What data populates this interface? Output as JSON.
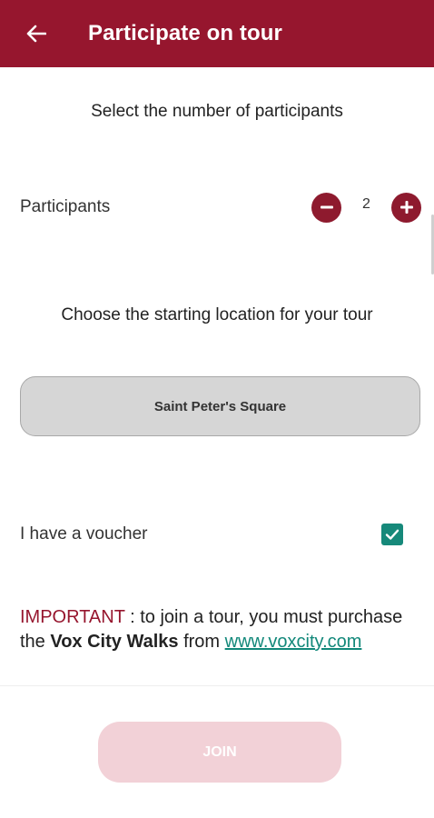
{
  "header": {
    "title": "Participate on tour",
    "back_icon": "arrow-left-icon",
    "background_color": "#96162e"
  },
  "participants_section": {
    "title": "Select the number of participants",
    "label": "Participants",
    "count": "2",
    "decrement_icon": "minus-circle-icon",
    "increment_icon": "plus-circle-icon"
  },
  "location_section": {
    "title": "Choose the starting location for your tour",
    "selected_location": "Saint Peter's Square"
  },
  "voucher": {
    "label": "I have a voucher",
    "checked": true,
    "checkbox_color": "#16897a"
  },
  "notice": {
    "important_label": "IMPORTANT",
    "text_before_brand": " : to join a tour, you must purchase the ",
    "brand": "Vox City Walks",
    "text_after_brand": " from ",
    "link_text": "www.voxcity.com"
  },
  "footer": {
    "join_label": "JOIN",
    "join_enabled": false
  }
}
